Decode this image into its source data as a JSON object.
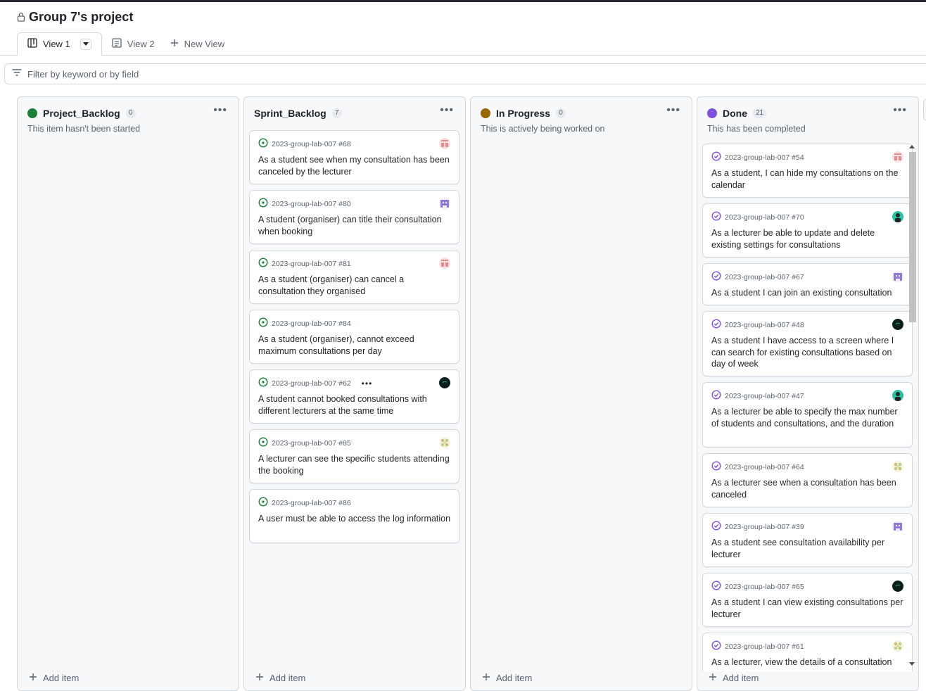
{
  "project": {
    "title": "Group 7's project",
    "lock_icon": "lock-icon"
  },
  "tabs": [
    {
      "label": "View 1",
      "icon": "board-icon",
      "active": true
    },
    {
      "label": "View 2",
      "icon": "table-icon",
      "active": false
    }
  ],
  "new_view_label": "New View",
  "filter": {
    "placeholder": "Filter by keyword or by field"
  },
  "add_item_label": "Add item",
  "columns": [
    {
      "name": "Project_Backlog",
      "count": "0",
      "color": "#1a7f37",
      "description": "This item hasn't been started",
      "cards": []
    },
    {
      "name": "Sprint_Backlog",
      "count": "7",
      "color": null,
      "description": "",
      "cards": [
        {
          "ref": "2023-group-lab-007 #68",
          "title": "As a student see when my consultation has been canceled by the lecturer",
          "avatar": "avatar-pink"
        },
        {
          "ref": "2023-group-lab-007 #80",
          "title": "A student (organiser) can title their consultation when booking",
          "avatar": "avatar-purple"
        },
        {
          "ref": "2023-group-lab-007 #81",
          "title": "As a student (organiser) can cancel a consultation they organised",
          "avatar": "avatar-pink"
        },
        {
          "ref": "2023-group-lab-007 #84",
          "title": "As a student (organiser), cannot exceed maximum consultations per day",
          "avatar": ""
        },
        {
          "ref": "2023-group-lab-007 #62",
          "title": "A student cannot booked consultations with different lecturers at the same time",
          "avatar": "avatar-dark",
          "more": "•••"
        },
        {
          "ref": "2023-group-lab-007 #85",
          "title": "A lecturer can see the specific students attending the booking",
          "avatar": "avatar-yellow"
        },
        {
          "ref": "2023-group-lab-007 #86",
          "title": "A user must be able to access the log information",
          "avatar": ""
        }
      ]
    },
    {
      "name": "In Progress",
      "count": "0",
      "color": "#9a6700",
      "description": "This is actively being worked on",
      "cards": []
    },
    {
      "name": "Done",
      "count": "21",
      "color": "#8250df",
      "description": "This has been completed",
      "cards": [
        {
          "ref": "2023-group-lab-007 #54",
          "title": "As a student, I can hide my consultations on the calendar",
          "avatar": "avatar-pink"
        },
        {
          "ref": "2023-group-lab-007 #70",
          "title": "As a lecturer be able to update and delete existing settings for consultations",
          "avatar": "avatar-teal"
        },
        {
          "ref": "2023-group-lab-007 #67",
          "title": "As a student I can join an existing consultation",
          "avatar": "avatar-purple"
        },
        {
          "ref": "2023-group-lab-007 #48",
          "title": "As a student I have access to a screen where I can search for existing consultations based on day of week",
          "avatar": "avatar-dark"
        },
        {
          "ref": "2023-group-lab-007 #47",
          "title": "As a lecturer be able to specify the max number of students and consultations, and the duration",
          "avatar": "avatar-teal"
        },
        {
          "ref": "2023-group-lab-007 #64",
          "title": "As a lecturer see when a consultation has been canceled",
          "avatar": "avatar-yellow"
        },
        {
          "ref": "2023-group-lab-007 #39",
          "title": "As a student see consultation availability per lecturer",
          "avatar": "avatar-purple"
        },
        {
          "ref": "2023-group-lab-007 #65",
          "title": "As a student I can view existing consultations per lecturer",
          "avatar": "avatar-dark"
        },
        {
          "ref": "2023-group-lab-007 #61",
          "title": "As a lecturer, view the details of a consultation",
          "avatar": "avatar-yellow"
        }
      ]
    }
  ]
}
